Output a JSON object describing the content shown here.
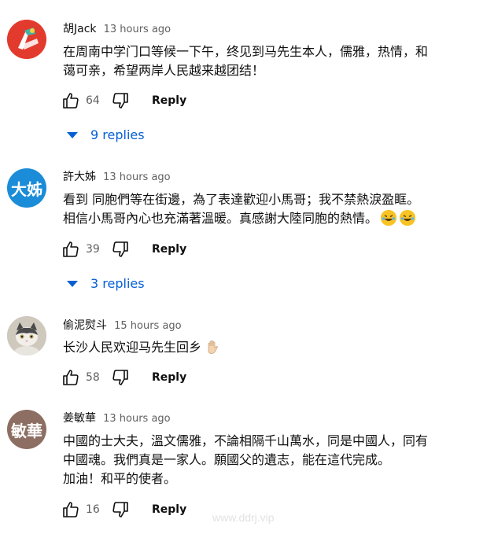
{
  "comments": [
    {
      "author": "胡Jack",
      "time": "13 hours ago",
      "lines": [
        "在周南中学门口等候一下午，终见到马先生本人，儒雅，热情，和",
        "蔼可亲，希望两岸人民越来越团结！"
      ],
      "likes": "64",
      "reply_label": "Reply",
      "replies": "9 replies"
    },
    {
      "author": "許大姊",
      "avatar_text": "大姊",
      "avatar_color": "#1a8cd8",
      "time": "13 hours ago",
      "lines": [
        "看到 同胞們等在街邊，為了表達歡迎小馬哥；我不禁熱淚盈眶。",
        "相信小馬哥內心也充滿著溫暖。真感謝大陸同胞的熱情。"
      ],
      "emoji": "laughing-with-tears-icon",
      "likes": "39",
      "reply_label": "Reply",
      "replies": "3 replies"
    },
    {
      "author": "偷泥熨斗",
      "time": "15 hours ago",
      "lines": [
        "长沙人民欢迎马先生回乡"
      ],
      "emoji": "waving-hand-icon",
      "likes": "58",
      "reply_label": "Reply"
    },
    {
      "author": "姜敏華",
      "avatar_text": "敏華",
      "avatar_color": "#8d6e63",
      "time": "13 hours ago",
      "lines": [
        "中國的士大夫，溫文儒雅，不論相隔千山萬水，同是中國人，同有",
        "中國魂。我們真是一家人。願國父的遺志，能在這代完成。",
        "加油！和平的使者。"
      ],
      "likes": "16",
      "reply_label": "Reply"
    }
  ],
  "watermark": "www.ddrj.vip",
  "colors": {
    "link_blue": "#065fd4",
    "secondary_text": "#606060"
  }
}
